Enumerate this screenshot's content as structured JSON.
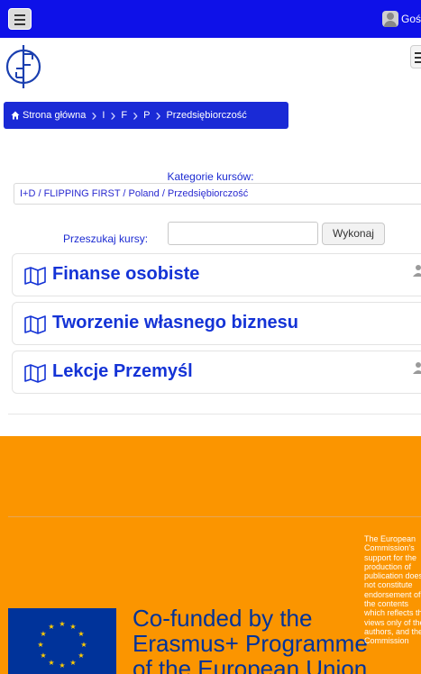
{
  "navbar": {
    "menu_icon": "hamburger-icon",
    "user_label": "Gość",
    "avatar_icon": "user-avatar-icon"
  },
  "header": {
    "logo_icon": "flipping-first-logo",
    "toggle_icon": "hamburger-icon"
  },
  "breadcrumb": {
    "home_icon": "home-icon",
    "items": [
      "Strona główna",
      "I",
      "F",
      "P",
      "Przedsiębiorczość"
    ]
  },
  "categories": {
    "label": "Kategorie kursów:",
    "selected": "I+D / FLIPPING FIRST / Poland / Przedsiębiorczość"
  },
  "search": {
    "label": "Przeszukaj kursy:",
    "value": "",
    "button_label": "Wykonaj"
  },
  "courses": [
    {
      "title": "Finanse osobiste",
      "icon": "map-icon",
      "side_icon": "user-icon"
    },
    {
      "title": "Tworzenie własnego biznesu",
      "icon": "map-icon"
    },
    {
      "title": "Lekcje Przemyśl",
      "icon": "map-icon",
      "side_icon": "user-icon"
    }
  ],
  "footer": {
    "flag_icon": "eu-flag-icon",
    "cofund_lines": [
      "Co-funded by the",
      "Erasmus+ Programme",
      "of the European Union"
    ],
    "disclaimer_lines": [
      "The European",
      "Commission's",
      "support for the",
      "production of",
      "publication does",
      "not constitute",
      "endorsement of",
      "the contents",
      "which reflects the",
      "views only of the",
      "authors, and the",
      "Commission"
    ],
    "colors": {
      "background": "#fb9500",
      "eu_blue": "#00339a"
    }
  },
  "colors": {
    "navbar": "#0e11e8",
    "breadcrumb": "#1a2ad6",
    "link": "#1433d6"
  }
}
